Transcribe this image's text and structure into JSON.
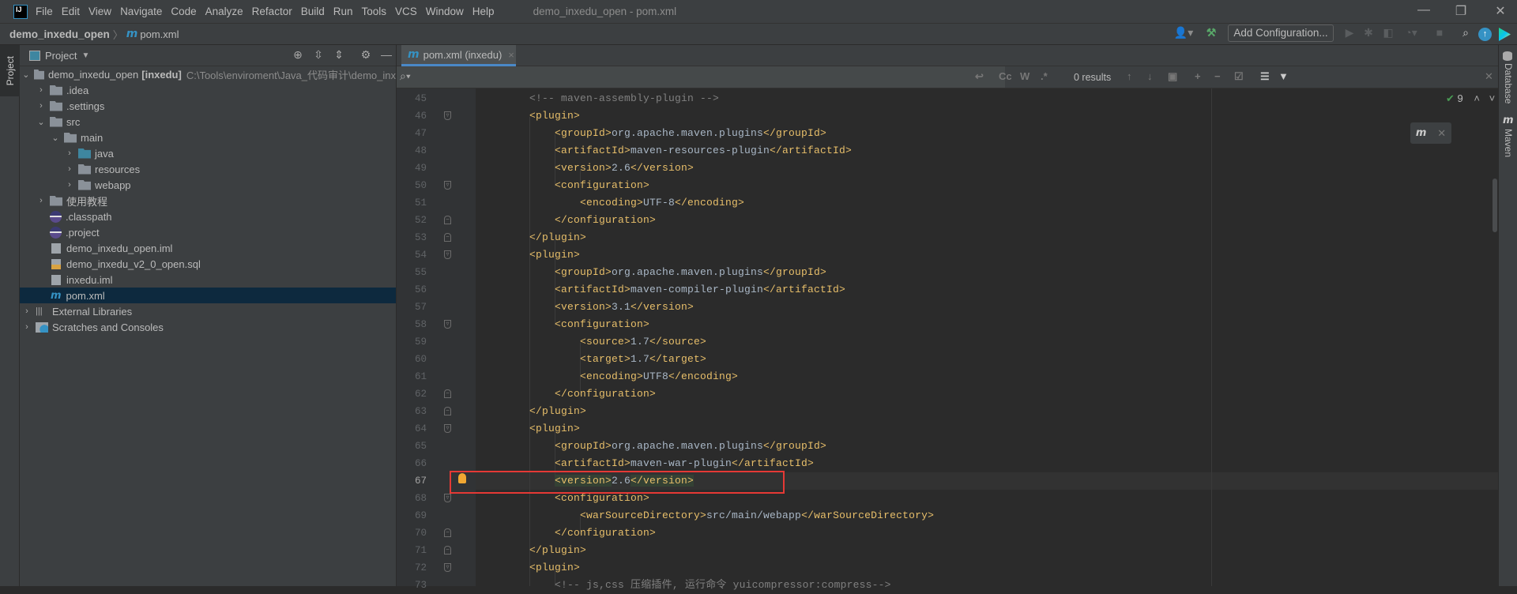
{
  "menubar": {
    "logo": "IJ",
    "items": [
      "File",
      "Edit",
      "View",
      "Navigate",
      "Code",
      "Analyze",
      "Refactor",
      "Build",
      "Run",
      "Tools",
      "VCS",
      "Window",
      "Help"
    ],
    "title": "demo_inxedu_open - pom.xml"
  },
  "navbar": {
    "project": "demo_inxedu_open",
    "file_icon": "m",
    "file": "pom.xml",
    "add_configuration": "Add Configuration..."
  },
  "left_stripe": {
    "project_tab": "Project"
  },
  "project_panel": {
    "title": "Project",
    "tree": [
      {
        "label": "demo_inxedu_open",
        "bold": "[inxedu]",
        "path": "C:\\Tools\\enviroment\\Java_代码审计\\demo_inx",
        "level": 0,
        "chevron": "down",
        "icon": "module-folder"
      },
      {
        "label": ".idea",
        "level": 1,
        "chevron": "right",
        "icon": "folder"
      },
      {
        "label": ".settings",
        "level": 1,
        "chevron": "right",
        "icon": "folder"
      },
      {
        "label": "src",
        "level": 1,
        "chevron": "down",
        "icon": "folder"
      },
      {
        "label": "main",
        "level": 2,
        "chevron": "down",
        "icon": "folder"
      },
      {
        "label": "java",
        "level": 3,
        "chevron": "right",
        "icon": "source-folder"
      },
      {
        "label": "resources",
        "level": 3,
        "chevron": "right",
        "icon": "resources-folder"
      },
      {
        "label": "webapp",
        "level": 3,
        "chevron": "right",
        "icon": "web-folder"
      },
      {
        "label": "使用教程",
        "level": 1,
        "chevron": "right",
        "icon": "folder"
      },
      {
        "label": ".classpath",
        "level": 1,
        "chevron": "",
        "icon": "eclipse"
      },
      {
        "label": ".project",
        "level": 1,
        "chevron": "",
        "icon": "eclipse"
      },
      {
        "label": "demo_inxedu_open.iml",
        "level": 1,
        "chevron": "",
        "icon": "iml-file"
      },
      {
        "label": "demo_inxedu_v2_0_open.sql",
        "level": 1,
        "chevron": "",
        "icon": "sql-file"
      },
      {
        "label": "inxedu.iml",
        "level": 1,
        "chevron": "",
        "icon": "iml-file"
      },
      {
        "label": "pom.xml",
        "level": 1,
        "chevron": "",
        "icon": "maven",
        "selected": true
      },
      {
        "label": "External Libraries",
        "level": 0,
        "chevron": "right",
        "icon": "libraries"
      },
      {
        "label": "Scratches and Consoles",
        "level": 0,
        "chevron": "right",
        "icon": "scratches"
      }
    ]
  },
  "editor": {
    "tab": {
      "icon": "m",
      "label": "pom.xml (inxedu)"
    },
    "find": {
      "results": "0 results",
      "match_case": "Cc",
      "words": "W",
      "regex": ".*"
    },
    "inspections": "9",
    "maven_popup_icon": "m",
    "highlight_line": 67,
    "lines": [
      {
        "n": "45",
        "i": 2,
        "cm": "<!-- maven-assembly-plugin -->"
      },
      {
        "n": "46",
        "i": 2,
        "o": "<plugin>"
      },
      {
        "n": "47",
        "i": 3,
        "o": "<groupId>",
        "t": "org.apache.maven.plugins",
        "c": "</groupId>"
      },
      {
        "n": "48",
        "i": 3,
        "o": "<artifactId>",
        "t": "maven-resources-plugin",
        "c": "</artifactId>"
      },
      {
        "n": "49",
        "i": 3,
        "o": "<version>",
        "t": "2.6",
        "c": "</version>"
      },
      {
        "n": "50",
        "i": 3,
        "o": "<configuration>"
      },
      {
        "n": "51",
        "i": 4,
        "o": "<encoding>",
        "t": "UTF-8",
        "c": "</encoding>"
      },
      {
        "n": "52",
        "i": 3,
        "o": "</configuration>"
      },
      {
        "n": "53",
        "i": 2,
        "o": "</plugin>"
      },
      {
        "n": "54",
        "i": 2,
        "o": "<plugin>"
      },
      {
        "n": "55",
        "i": 3,
        "o": "<groupId>",
        "t": "org.apache.maven.plugins",
        "c": "</groupId>"
      },
      {
        "n": "56",
        "i": 3,
        "o": "<artifactId>",
        "t": "maven-compiler-plugin",
        "c": "</artifactId>"
      },
      {
        "n": "57",
        "i": 3,
        "o": "<version>",
        "t": "3.1",
        "c": "</version>"
      },
      {
        "n": "58",
        "i": 3,
        "o": "<configuration>"
      },
      {
        "n": "59",
        "i": 4,
        "o": "<source>",
        "t": "1.7",
        "c": "</source>"
      },
      {
        "n": "60",
        "i": 4,
        "o": "<target>",
        "t": "1.7",
        "c": "</target>"
      },
      {
        "n": "61",
        "i": 4,
        "o": "<encoding>",
        "t": "UTF8",
        "c": "</encoding>"
      },
      {
        "n": "62",
        "i": 3,
        "o": "</configuration>"
      },
      {
        "n": "63",
        "i": 2,
        "o": "</plugin>"
      },
      {
        "n": "64",
        "i": 2,
        "o": "<plugin>"
      },
      {
        "n": "65",
        "i": 3,
        "o": "<groupId>",
        "t": "org.apache.maven.plugins",
        "c": "</groupId>"
      },
      {
        "n": "66",
        "i": 3,
        "o": "<artifactId>",
        "t": "maven-war-plugin",
        "c": "</artifactId>"
      },
      {
        "n": "67",
        "i": 3,
        "o": "<version>",
        "t": "2.6",
        "c": "</version>"
      },
      {
        "n": "68",
        "i": 3,
        "o": "<configuration>"
      },
      {
        "n": "69",
        "i": 4,
        "o": "<warSourceDirectory>",
        "t": "src/main/webapp",
        "c": "</warSourceDirectory>"
      },
      {
        "n": "70",
        "i": 3,
        "o": "</configuration>"
      },
      {
        "n": "71",
        "i": 2,
        "o": "</plugin>"
      },
      {
        "n": "72",
        "i": 2,
        "o": "<plugin>"
      },
      {
        "n": "73",
        "i": 3,
        "cm": "<!-- js,css 压缩插件, 运行命令 yuicompressor:compress-->"
      }
    ],
    "fold_open": [
      "46",
      "50",
      "54",
      "58",
      "64",
      "68",
      "72"
    ],
    "fold_close": [
      "52",
      "53",
      "62",
      "63",
      "70",
      "71"
    ]
  },
  "right_stripe": {
    "database": "Database",
    "maven": "Maven"
  },
  "colors": {
    "tag": "#e8bf6a",
    "text": "#a9b7c6",
    "comment": "#808080",
    "selection": "#0d293e",
    "accent": "#4a88c7",
    "annotation_box": "#e53935"
  }
}
